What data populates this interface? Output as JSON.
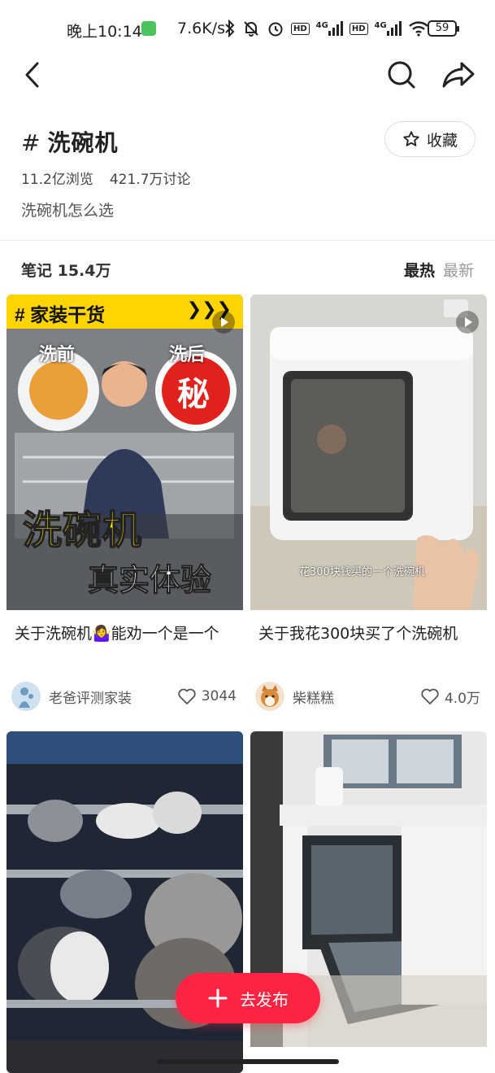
{
  "status_bar": {
    "time": "晚上10:14",
    "net_speed": "7.6K/s",
    "hd1": "HD",
    "net1": "4G",
    "hd2": "HD",
    "net2": "4G",
    "battery": "59"
  },
  "topic": {
    "hash": "#",
    "name": "洗碗机",
    "favorite_label": "收藏",
    "views": "11.2亿浏览",
    "discussions": "421.7万讨论",
    "subtitle": "洗碗机怎么选"
  },
  "notes": {
    "count": "笔记 15.4万",
    "sort_hot": "最热",
    "sort_new": "最新"
  },
  "cards": [
    {
      "banner": "# 家装干货",
      "before": "洗前",
      "after": "洗后",
      "secret": "秘",
      "headline": "洗碗机",
      "subheadline": "真实体验",
      "title": "关于洗碗机🤷‍♀️能劝一个是一个",
      "author": "老爸评测家装",
      "likes": "3044"
    },
    {
      "caption": "花300块钱买的一个洗碗机",
      "title": "关于我花300块买了个洗碗机",
      "author": "柴糕糕",
      "likes": "4.0万"
    }
  ],
  "fab": {
    "label": "去发布"
  },
  "colors": {
    "accent": "#ff2442",
    "banner_yellow": "#ffd400"
  }
}
